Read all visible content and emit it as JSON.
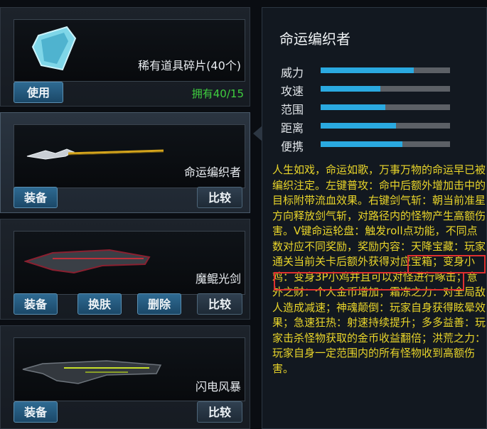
{
  "items": [
    {
      "name": "稀有道具碎片(40个)",
      "count": "拥有40/15",
      "buttons": [
        "使用"
      ]
    },
    {
      "name": "命运编织者",
      "buttons": [
        "装备",
        "比较"
      ]
    },
    {
      "name": "魔鲲光剑",
      "buttons": [
        "装备",
        "换肤",
        "删除",
        "比较"
      ]
    },
    {
      "name": "闪电风暴",
      "buttons": [
        "装备",
        "比较"
      ]
    }
  ],
  "detail": {
    "title": "命运编织者",
    "stats": [
      {
        "label": "威力",
        "value": 0.72
      },
      {
        "label": "攻速",
        "value": 0.46
      },
      {
        "label": "范围",
        "value": 0.5
      },
      {
        "label": "距离",
        "value": 0.58
      },
      {
        "label": "便携",
        "value": 0.63
      }
    ],
    "description": "人生如戏，命运如歌，万事万物的命运早已被编织注定。左键普攻：命中后额外增加击中的目标附带流血效果。右键剑气斩：朝当前准星方向释放剑气斩，对路径内的怪物产生高额伤害。V键命运轮盘：触发roll点功能，不同点数对应不同奖励，奖励内容：天降宝藏：玩家通关当前关卡后额外获得对应宝箱；变身小鸡：变身3P小鸡并且可以对怪进行啄击；意外之财：个人金币增加；霜冻之力：对全局敌人造成减速；神魂颠倒：玩家自身获得眩晕效果；急速狂热：射速持续提升；多多益善：玩家击杀怪物获取的金币收益翻倍；洪荒之力：玩家自身一定范围内的所有怪物收到高额伤害。"
  },
  "colors": {
    "accent": "#2aa9e0",
    "description": "#e9d52a",
    "owned": "#3fcf3f",
    "highlight": "#e03030"
  }
}
